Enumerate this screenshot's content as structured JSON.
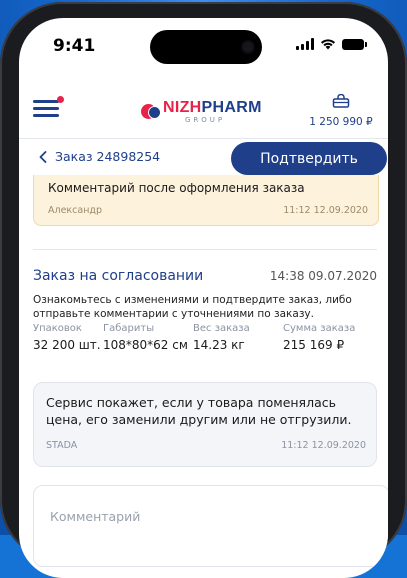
{
  "status_bar": {
    "time": "9:41"
  },
  "header": {
    "cart_total": "1 250 990 ₽"
  },
  "brand": {
    "name_accent": "NIZH",
    "name_main": "PHARM",
    "sub": "GROUP"
  },
  "order_bar": {
    "title": "Заказ 24898254",
    "confirm_label": "Подтвердить"
  },
  "previous_comment": {
    "text": "Комментарий после оформления заказа",
    "author": "Александр",
    "time": "11:12 12.09.2020"
  },
  "order_status": {
    "title": "Заказ на согласовании",
    "time": "14:38 09.07.2020",
    "description": "Ознакомьтесь с изменениями и подтвердите заказ, либо отправьте комментарии с уточнениями по заказу."
  },
  "stats": [
    {
      "label": "Упаковок",
      "value": "32 200 шт."
    },
    {
      "label": "Габариты",
      "value": "108*80*62 см"
    },
    {
      "label": "Вес заказа",
      "value": "14.23 кг"
    },
    {
      "label": "Сумма заказа",
      "value": "215 169 ₽"
    }
  ],
  "service_message": {
    "text": "Сервис покажет, если у товара поменялась цена, его заменили другим или не отгрузили.",
    "author": "STADA",
    "time": "11:12 12.09.2020"
  },
  "comment_input": {
    "placeholder": "Комментарий",
    "value": ""
  },
  "colors": {
    "primary": "#1f3f8a",
    "accent": "#e8234a",
    "comment_bg": "#fdf2dc"
  },
  "icons": [
    "menu-icon",
    "cart-icon",
    "chevron-left-icon",
    "signal-icon",
    "wifi-icon",
    "battery-icon"
  ]
}
